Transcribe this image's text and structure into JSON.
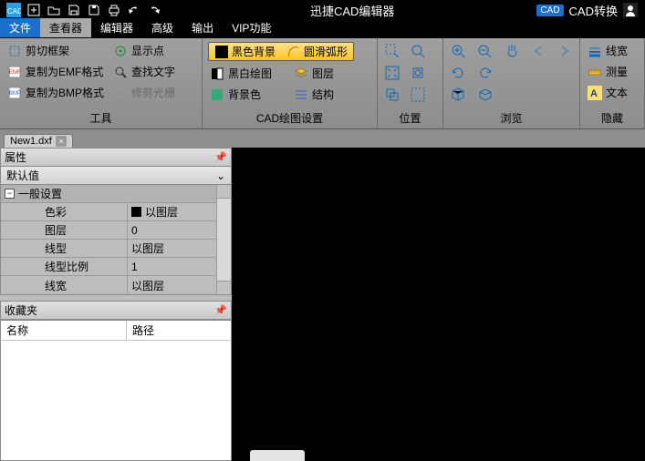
{
  "app_title": "迅捷CAD编辑器",
  "title_right": {
    "cad_btn": "CAD",
    "cad_convert": "CAD转换"
  },
  "menus": {
    "file": "文件",
    "viewer": "查看器",
    "editor": "编辑器",
    "advanced": "高级",
    "output": "输出",
    "vip": "VIP功能"
  },
  "ribbon": {
    "tools": {
      "label": "工具",
      "crop": "剪切框架",
      "copy_emf": "复制为EMF格式",
      "copy_bmp": "复制为BMP格式",
      "show_point": "显示点",
      "find_text": "查找文字",
      "trim_grid": "修剪光栅"
    },
    "cad_draw": {
      "label": "CAD绘图设置",
      "black_bg": "黑色背景",
      "smooth_arc": "圆滑弧形",
      "bw_draw": "黑白绘图",
      "layers": "图层",
      "bg_color": "背景色",
      "structure": "结构"
    },
    "position": {
      "label": "位置"
    },
    "browse": {
      "label": "浏览"
    },
    "hide": {
      "label": "隐藏",
      "linewidth": "线宽",
      "measure": "测量",
      "text": "文本"
    }
  },
  "doc_tab": "New1.dxf",
  "props": {
    "title": "属性",
    "default": "默认值",
    "cat_general": "一般设置",
    "rows": {
      "color_k": "色彩",
      "color_v": "以图层",
      "layer_k": "图层",
      "layer_v": "0",
      "ltype_k": "线型",
      "ltype_v": "以图层",
      "lscale_k": "线型比例",
      "lscale_v": "1",
      "lw_k": "线宽",
      "lw_v": "以图层"
    }
  },
  "fav": {
    "title": "收藏夹",
    "col_name": "名称",
    "col_path": "路径"
  }
}
